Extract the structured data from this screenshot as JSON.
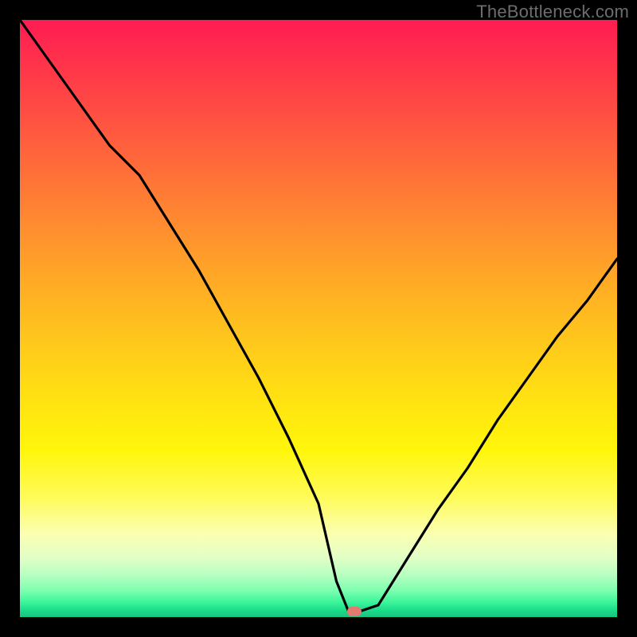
{
  "watermark": "TheBottleneck.com",
  "chart_data": {
    "type": "line",
    "title": "",
    "xlabel": "",
    "ylabel": "",
    "xlim": [
      0,
      100
    ],
    "ylim": [
      0,
      100
    ],
    "grid": false,
    "legend": false,
    "background": "rainbow-gradient-vertical",
    "series": [
      {
        "name": "bottleneck-curve",
        "color": "#000000",
        "x": [
          0,
          5,
          10,
          15,
          20,
          25,
          30,
          35,
          40,
          45,
          50,
          53,
          55,
          57,
          60,
          65,
          70,
          75,
          80,
          85,
          90,
          95,
          100
        ],
        "y": [
          100,
          93,
          86,
          79,
          74,
          66,
          58,
          49,
          40,
          30,
          19,
          6,
          1,
          1,
          2,
          10,
          18,
          25,
          33,
          40,
          47,
          53,
          60
        ]
      }
    ],
    "marker": {
      "name": "optimal-point",
      "x": 56,
      "y": 1,
      "color": "#e37a71"
    },
    "gradient_stops": [
      {
        "pos": 0,
        "color": "#ff1c52"
      },
      {
        "pos": 50,
        "color": "#ffc81c"
      },
      {
        "pos": 85,
        "color": "#fbffb1"
      },
      {
        "pos": 100,
        "color": "#17c67f"
      }
    ]
  }
}
